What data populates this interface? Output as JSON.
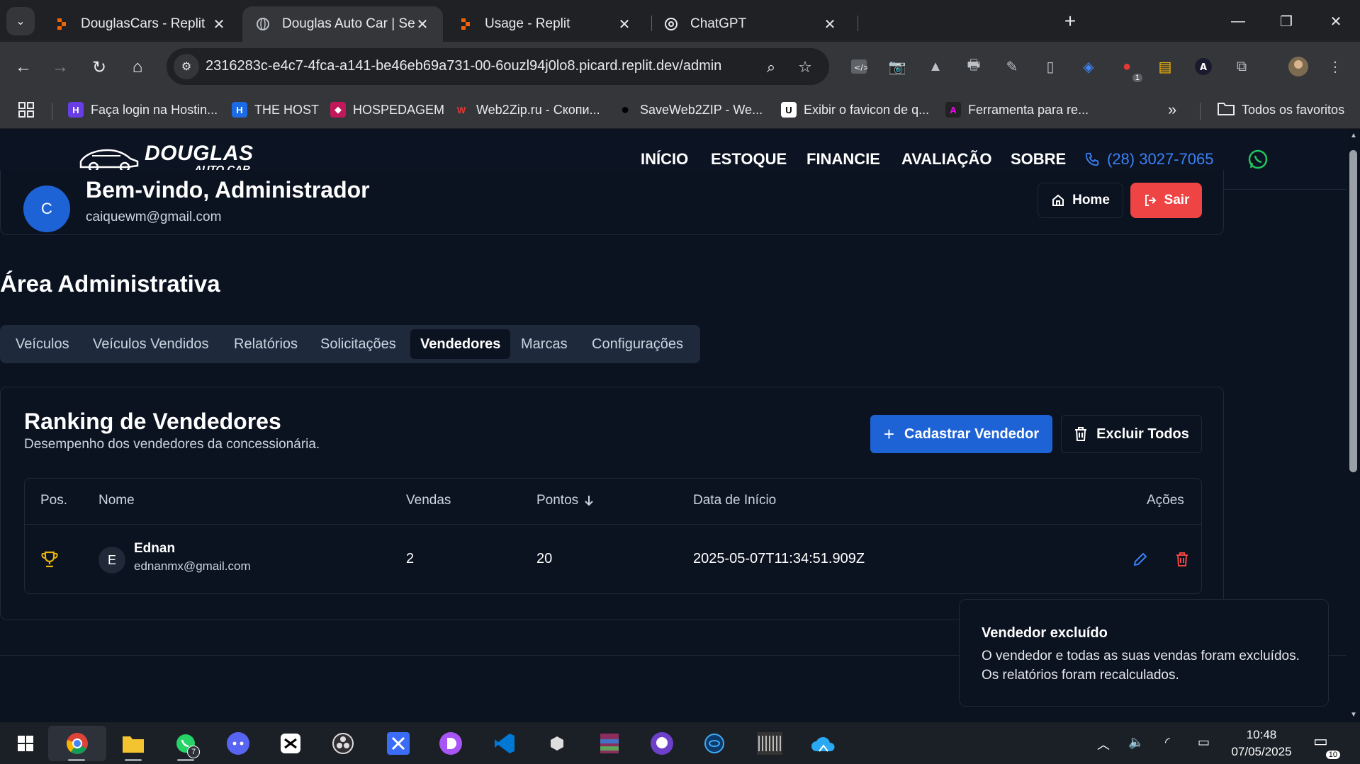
{
  "browser": {
    "tabs": [
      {
        "title": "DouglasCars - Replit",
        "icon": "replit-icon"
      },
      {
        "title": "Douglas Auto Car | Seu Próximo",
        "icon": "globe-icon",
        "active": true
      },
      {
        "title": "Usage - Replit",
        "icon": "replit-icon"
      },
      {
        "title": "ChatGPT",
        "icon": "chatgpt-icon"
      }
    ],
    "url": "2316283c-e4c7-4fca-a141-be46eb69a731-00-6ouzl94j0lo8.picard.replit.dev/admin",
    "extension_badge": "1",
    "bookmarks": [
      {
        "label": "Faça login na Hostin...",
        "color": "#673de6",
        "glyph": "H"
      },
      {
        "label": "THE HOST",
        "color": "#1d6ae5",
        "glyph": "H"
      },
      {
        "label": "HOSPEDAGEM",
        "color": "#c2185b",
        "glyph": "◆"
      },
      {
        "label": "Web2Zip.ru - Скопи...",
        "color": "#d32f2f",
        "glyph": "W"
      },
      {
        "label": "SaveWeb2ZIP - We...",
        "color": "#111111",
        "glyph": "●"
      },
      {
        "label": "Exibir o favicon de q...",
        "color": "#ffffff",
        "glyph": "U"
      },
      {
        "label": "Ferramenta para re...",
        "color": "#222222",
        "glyph": "A"
      }
    ],
    "bookmarks_more": "»",
    "all_bookmarks": "Todos os favoritos"
  },
  "site": {
    "logo_main": "DOUGLAS",
    "logo_sub": "AUTO CAR",
    "menu": [
      "INÍCIO",
      "ESTOQUE",
      "FINANCIE",
      "AVALIAÇÃO",
      "SOBRE"
    ],
    "phone": "(28) 3027-7065",
    "accent": "#1e63d6",
    "danger": "#ef4444"
  },
  "welcome": {
    "avatar_letter": "C",
    "title": "Bem-vindo, Administrador",
    "email": "caiquewm@gmail.com",
    "home_label": "Home",
    "logout_label": "Sair"
  },
  "admin": {
    "title": "Área Administrativa",
    "tabs": [
      "Veículos",
      "Veículos Vendidos",
      "Relatórios",
      "Solicitações",
      "Vendedores",
      "Marcas",
      "Configurações"
    ],
    "active_tab": "Vendedores"
  },
  "ranking": {
    "title": "Ranking de Vendedores",
    "subtitle": "Desempenho dos vendedores da concessionária.",
    "add_label": "Cadastrar Vendedor",
    "delete_all_label": "Excluir Todos",
    "columns": [
      "Pos.",
      "Nome",
      "Vendas",
      "Pontos",
      "Data de Início",
      "Ações"
    ],
    "rows": [
      {
        "position_icon": "trophy-icon",
        "avatar": "E",
        "name": "Ednan",
        "email": "ednanmx@gmail.com",
        "sales": "2",
        "points": "20",
        "start": "2025-05-07T11:34:51.909Z"
      }
    ]
  },
  "toast": {
    "title": "Vendedor excluído",
    "body": "O vendedor e todas as suas vendas foram excluídos. Os relatórios foram recalculados."
  },
  "taskbar": {
    "whatsapp_badge": "7",
    "time": "10:48",
    "date": "07/05/2025",
    "notifications": "10"
  }
}
